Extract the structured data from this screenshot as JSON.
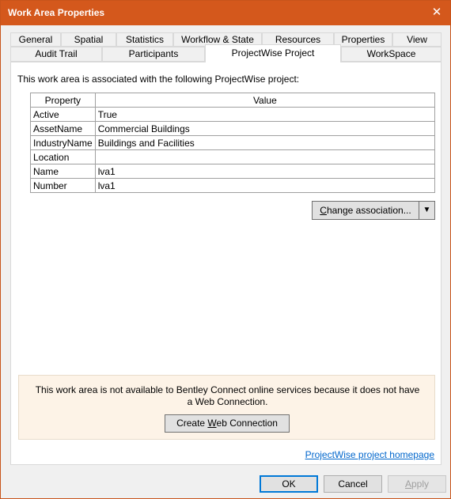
{
  "window": {
    "title": "Work Area Properties",
    "close_glyph": "✕"
  },
  "tabs": {
    "row1": [
      "General",
      "Spatial",
      "Statistics",
      "Workflow & State",
      "Resources",
      "Properties",
      "View"
    ],
    "row2": [
      "Audit Trail",
      "Participants",
      "ProjectWise Project",
      "WorkSpace"
    ],
    "selected": "ProjectWise Project"
  },
  "panel": {
    "intro": "This work area is associated with the following ProjectWise project:",
    "table": {
      "headers": [
        "Property",
        "Value"
      ],
      "rows": [
        [
          "Active",
          "True"
        ],
        [
          "AssetName",
          "Commercial Buildings"
        ],
        [
          "IndustryName",
          "Buildings and Facilities"
        ],
        [
          "Location",
          ""
        ],
        [
          "Name",
          "lva1"
        ],
        [
          "Number",
          "lva1"
        ]
      ]
    },
    "change_association": {
      "label_mnemonic": "C",
      "label_rest": "hange association...",
      "arrow": "▼"
    },
    "notice": {
      "text": "This work area is not available to Bentley Connect online services because it does not have a Web Connection.",
      "button_pre": "Create ",
      "button_mnemonic": "W",
      "button_post": "eb Connection"
    },
    "homepage_link": "ProjectWise project homepage"
  },
  "footer": {
    "ok": "OK",
    "cancel": "Cancel",
    "apply_mnemonic": "A",
    "apply_rest": "pply"
  }
}
